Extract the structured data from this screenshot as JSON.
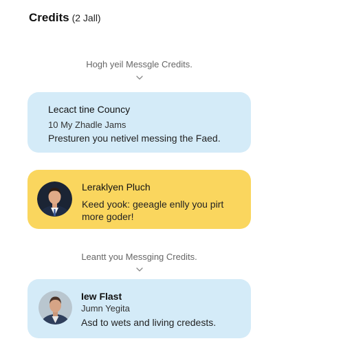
{
  "header": {
    "title": "Credits",
    "subtitle": "(2 Jall)"
  },
  "sections": [
    {
      "label": "Hogh yeil Messgle Credits."
    },
    {
      "label": "Leantt you Messging Credits."
    }
  ],
  "cards": [
    {
      "title": "Lecact tine Councy",
      "subtitle": "10 My Zhadle Jams",
      "body": "Presturen you netivel messing the Faed.",
      "color": "#d4ebf8"
    },
    {
      "title": "Leraklyen Pluch",
      "body": "Keed yook: geeagle enlly you pirt more goder!",
      "color": "#fad65e",
      "avatar_icon": "person-avatar-icon"
    },
    {
      "title": "Iew Flast",
      "subtitle": "Jumn Yegita",
      "body": "Asd to wets and living credests.",
      "color": "#d4ebf8",
      "avatar_icon": "person-avatar-icon"
    }
  ]
}
